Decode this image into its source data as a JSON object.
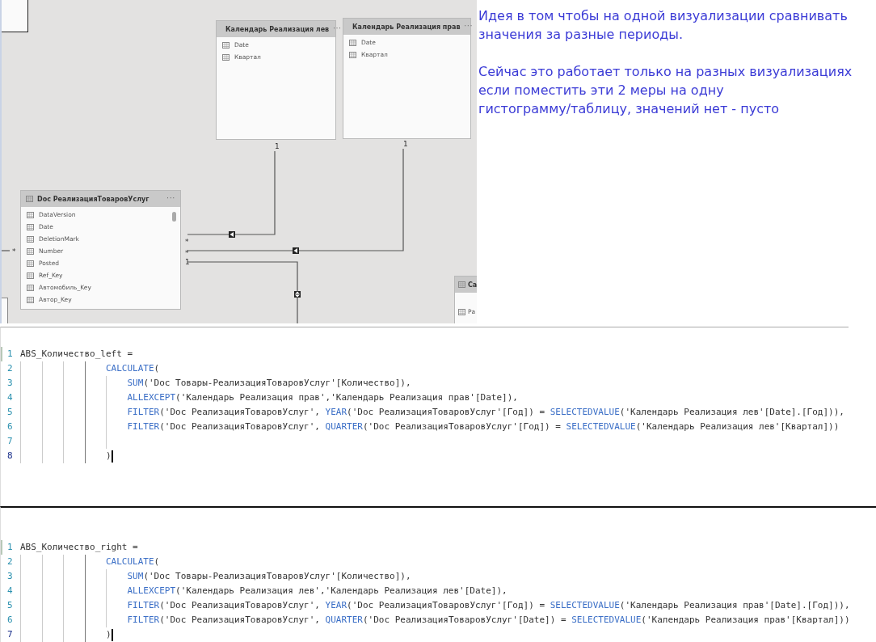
{
  "diagram": {
    "tables": [
      {
        "title": "Календарь Реализация лев",
        "menu": "···",
        "fields": [
          "Date",
          "Квартал"
        ]
      },
      {
        "title": "Календарь Реализация прав",
        "menu": "···",
        "fields": [
          "Date",
          "Квартал"
        ]
      },
      {
        "title": "Doc РеализацияТоваровУслуг",
        "menu": "···",
        "fields": [
          "DataVersion",
          "Date",
          "DeletionMark",
          "Number",
          "Posted",
          "Ref_Key",
          "Автомобиль_Key",
          "Автор_Key"
        ]
      },
      {
        "title": "Ca",
        "fields": [
          "Ра"
        ]
      }
    ],
    "cardinality_labels": [
      "1",
      "1",
      "*",
      "*",
      "1",
      "*"
    ]
  },
  "note": {
    "paragraphs": [
      {
        "lines": [
          "Идея в том чтобы на одной визуализации сравнивать",
          "значения за разные периоды."
        ]
      },
      {
        "lines": [
          "Сейчас это работает только на разных визуализациях",
          "если поместить эти 2 меры на одну",
          "гистограмму/таблицу, значений нет - пусто"
        ]
      }
    ]
  },
  "code_blocks": [
    {
      "lines": [
        {
          "number": "1",
          "kind": "header",
          "cursor": false,
          "tokens": [
            {
              "kind": "text",
              "text": "ABS_Количество_left ="
            }
          ]
        },
        {
          "number": "2",
          "kind": "call",
          "cursor": false,
          "tokens": [
            {
              "kind": "keyword",
              "text": "CALCULATE"
            },
            {
              "kind": "text",
              "text": "("
            }
          ]
        },
        {
          "number": "3",
          "kind": "argument",
          "cursor": false,
          "tokens": [
            {
              "kind": "keyword",
              "text": "SUM"
            },
            {
              "kind": "text",
              "text": "('Doc Товары-РеализацияТоваровУслуг'[Количество]),"
            }
          ]
        },
        {
          "number": "4",
          "kind": "argument",
          "cursor": false,
          "tokens": [
            {
              "kind": "keyword",
              "text": "ALLEXCEPT"
            },
            {
              "kind": "text",
              "text": "('Календарь Реализация прав','Календарь Реализация прав'[Date]),"
            }
          ]
        },
        {
          "number": "5",
          "kind": "argument",
          "cursor": false,
          "tokens": [
            {
              "kind": "keyword",
              "text": "FILTER"
            },
            {
              "kind": "text",
              "text": "('Doc РеализацияТоваровУслуг', "
            },
            {
              "kind": "keyword",
              "text": "YEAR"
            },
            {
              "kind": "text",
              "text": "('Doc РеализацияТоваровУслуг'[Год]) = "
            },
            {
              "kind": "keyword",
              "text": "SELECTEDVALUE"
            },
            {
              "kind": "text",
              "text": "('Календарь Реализация лев'[Date].[Год])),"
            }
          ]
        },
        {
          "number": "6",
          "kind": "argument",
          "cursor": false,
          "tokens": [
            {
              "kind": "keyword",
              "text": "FILTER"
            },
            {
              "kind": "text",
              "text": "('Doc РеализацияТоваровУслуг', "
            },
            {
              "kind": "keyword",
              "text": "QUARTER"
            },
            {
              "kind": "text",
              "text": "('Doc РеализацияТоваровУслуг'[Год]) = "
            },
            {
              "kind": "keyword",
              "text": "SELECTEDVALUE"
            },
            {
              "kind": "text",
              "text": "('Календарь Реализация лев'[Квартал]))"
            }
          ]
        },
        {
          "number": "7",
          "kind": "blank",
          "cursor": false
        },
        {
          "number": "8",
          "kind": "close",
          "cursor": true,
          "tokens": [
            {
              "kind": "text",
              "text": ")"
            }
          ]
        }
      ]
    },
    {
      "lines": [
        {
          "number": "1",
          "kind": "header",
          "cursor": false,
          "tokens": [
            {
              "kind": "text",
              "text": "ABS_Количество_right ="
            }
          ]
        },
        {
          "number": "2",
          "kind": "call",
          "cursor": false,
          "tokens": [
            {
              "kind": "keyword",
              "text": "CALCULATE"
            },
            {
              "kind": "text",
              "text": "("
            }
          ]
        },
        {
          "number": "3",
          "kind": "argument",
          "cursor": false,
          "tokens": [
            {
              "kind": "keyword",
              "text": "SUM"
            },
            {
              "kind": "text",
              "text": "('Doc Товары-РеализацияТоваровУслуг'[Количество]),"
            }
          ]
        },
        {
          "number": "4",
          "kind": "argument",
          "cursor": false,
          "tokens": [
            {
              "kind": "keyword",
              "text": "ALLEXCEPT"
            },
            {
              "kind": "text",
              "text": "('Календарь Реализация лев','Календарь Реализация лев'[Date]),"
            }
          ]
        },
        {
          "number": "5",
          "kind": "argument",
          "cursor": false,
          "tokens": [
            {
              "kind": "keyword",
              "text": "FILTER"
            },
            {
              "kind": "text",
              "text": "('Doc РеализацияТоваровУслуг', "
            },
            {
              "kind": "keyword",
              "text": "YEAR"
            },
            {
              "kind": "text",
              "text": "('Doc РеализацияТоваровУслуг'[Год]) = "
            },
            {
              "kind": "keyword",
              "text": "SELECTEDVALUE"
            },
            {
              "kind": "text",
              "text": "('Календарь Реализация прав'[Date].[Год])),"
            }
          ]
        },
        {
          "number": "6",
          "kind": "argument",
          "cursor": false,
          "tokens": [
            {
              "kind": "keyword",
              "text": "FILTER"
            },
            {
              "kind": "text",
              "text": "('Doc РеализацияТоваровУслуг', "
            },
            {
              "kind": "keyword",
              "text": "QUARTER"
            },
            {
              "kind": "text",
              "text": "('Doc РеализацияТоваровУслуг'[Date]) = "
            },
            {
              "kind": "keyword",
              "text": "SELECTEDVALUE"
            },
            {
              "kind": "text",
              "text": "('Календарь Реализация прав'[Квартал]))"
            }
          ]
        },
        {
          "number": "7",
          "kind": "close",
          "cursor": true,
          "tokens": [
            {
              "kind": "text",
              "text": ")"
            }
          ]
        }
      ]
    }
  ]
}
